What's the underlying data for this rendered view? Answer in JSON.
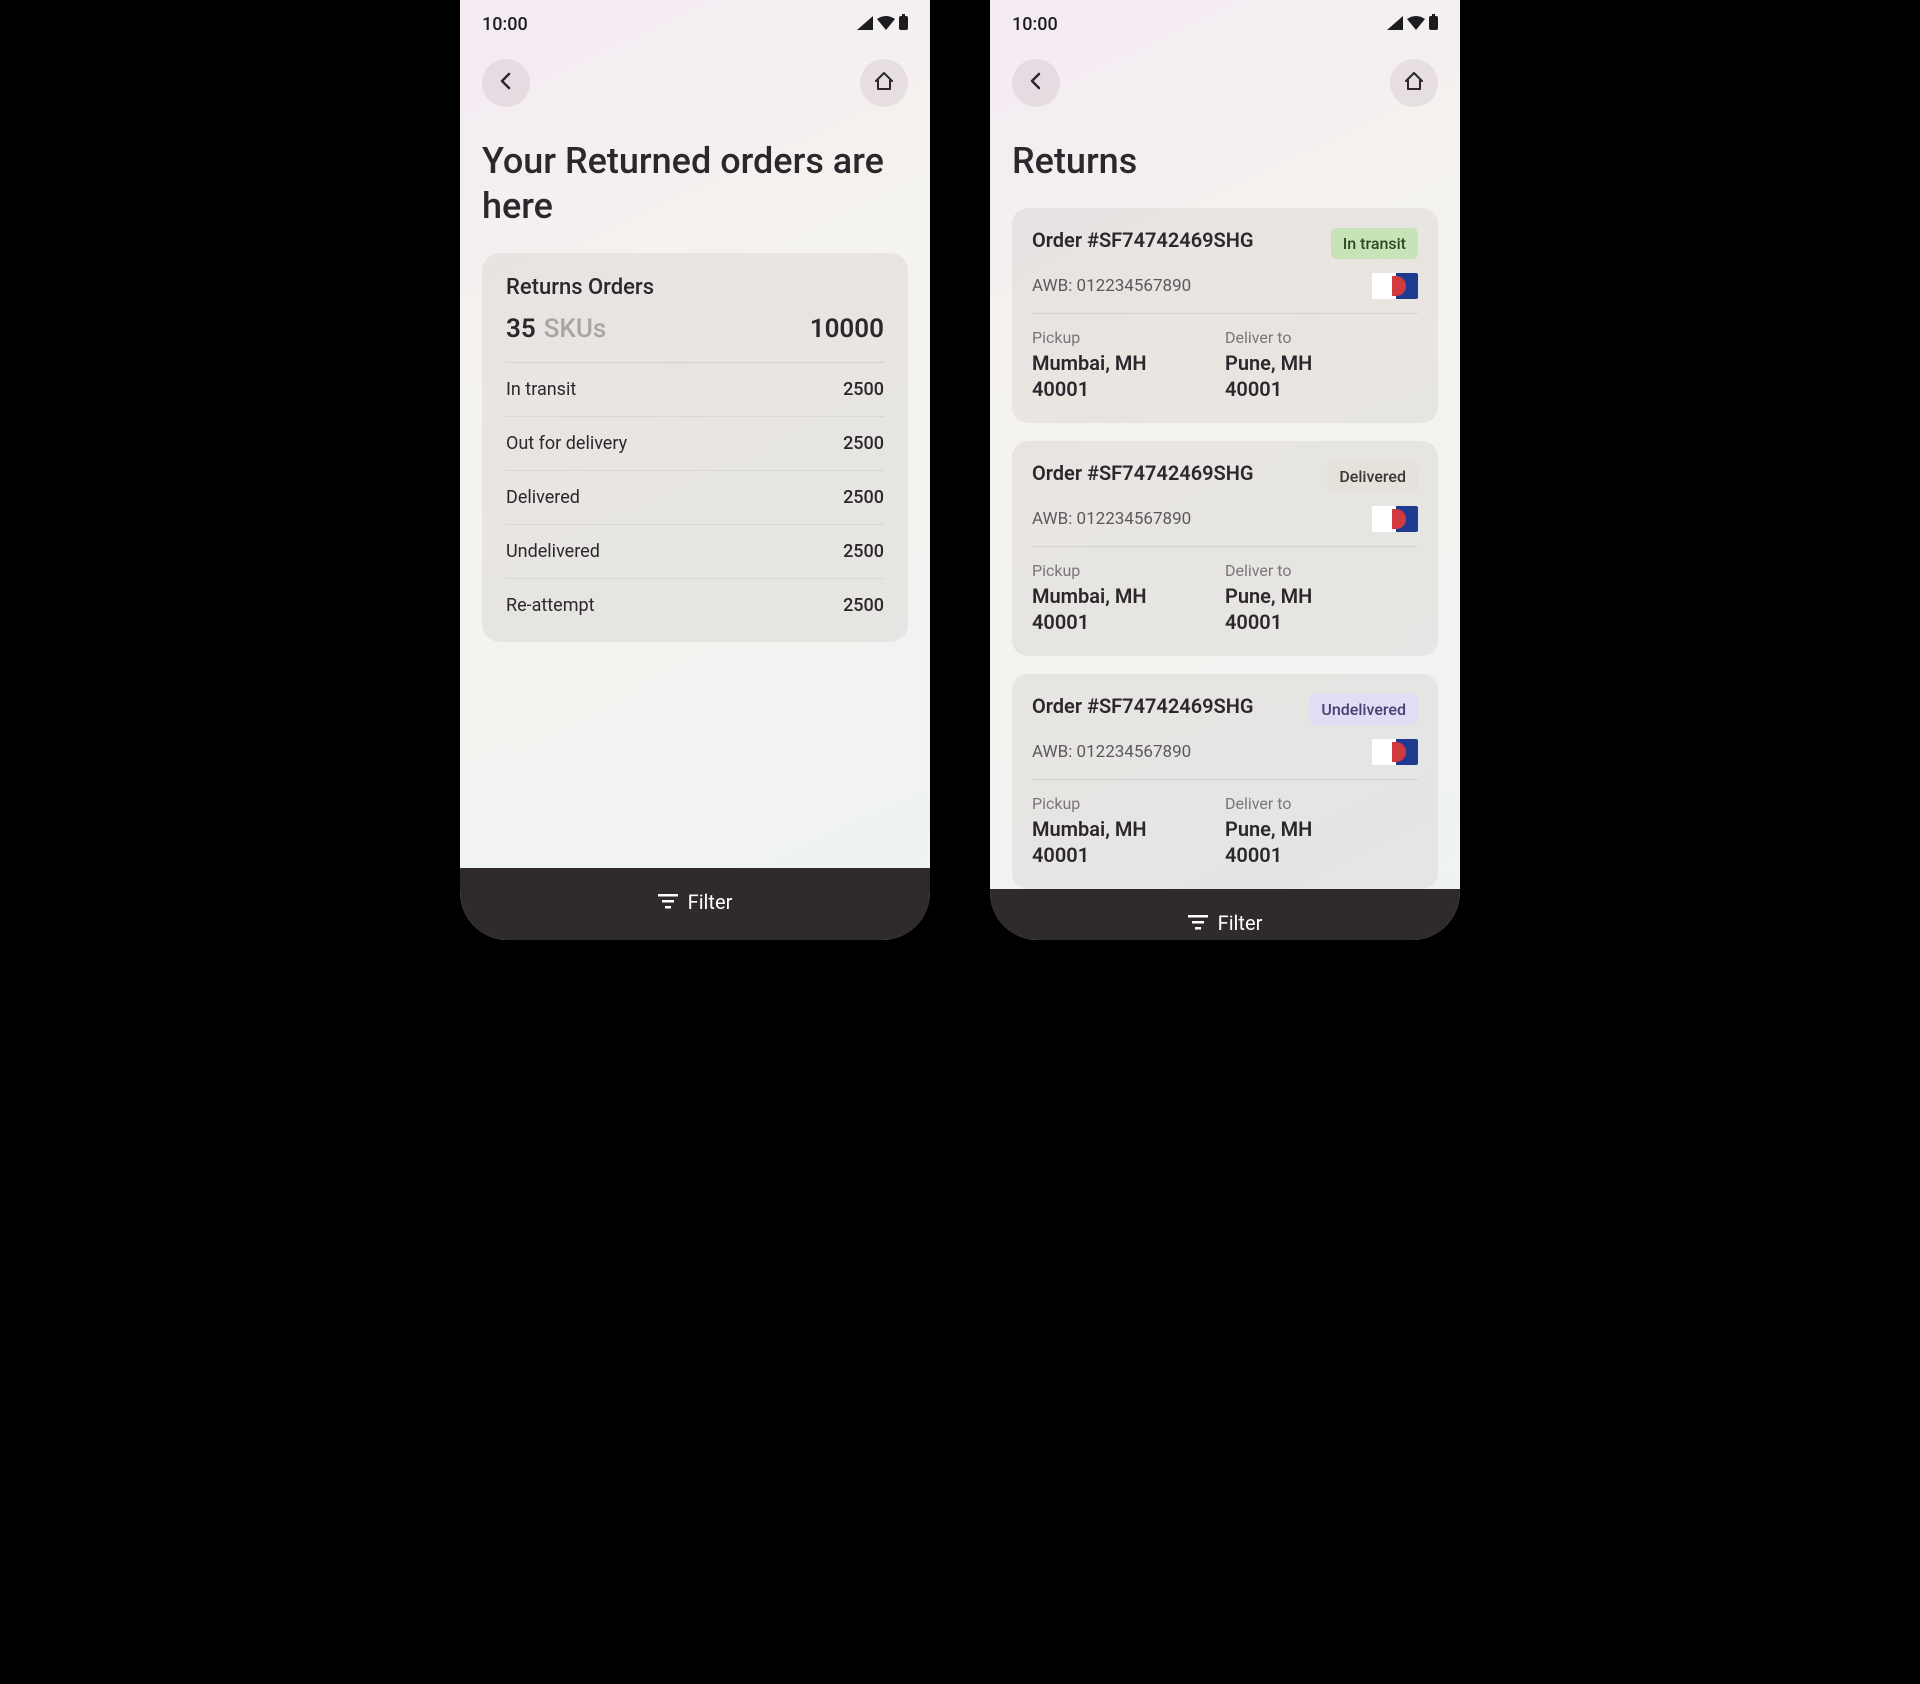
{
  "statusbar": {
    "time": "10:00"
  },
  "screen1": {
    "title": "Your Returned orders are here",
    "summary": {
      "title": "Returns Orders",
      "sku_count": "35",
      "sku_label": "SKUs",
      "total": "10000",
      "rows": [
        {
          "label": "In transit",
          "value": "2500"
        },
        {
          "label": "Out for delivery",
          "value": "2500"
        },
        {
          "label": "Delivered",
          "value": "2500"
        },
        {
          "label": "Undelivered",
          "value": "2500"
        },
        {
          "label": "Re-attempt",
          "value": "2500"
        }
      ]
    },
    "footer": {
      "filter": "Filter"
    }
  },
  "screen2": {
    "title": "Returns",
    "orders": [
      {
        "id": "Order #SF74742469SHG",
        "status": "In transit",
        "status_kind": "transit",
        "awb": "AWB: 012234567890",
        "pickup_label": "Pickup",
        "pickup_city": "Mumbai, MH",
        "pickup_pin": "40001",
        "deliver_label": "Deliver to",
        "deliver_city": "Pune, MH",
        "deliver_pin": "40001"
      },
      {
        "id": "Order #SF74742469SHG",
        "status": "Delivered",
        "status_kind": "delivered",
        "awb": "AWB: 012234567890",
        "pickup_label": "Pickup",
        "pickup_city": "Mumbai, MH",
        "pickup_pin": "40001",
        "deliver_label": "Deliver to",
        "deliver_city": "Pune, MH",
        "deliver_pin": "40001"
      },
      {
        "id": "Order #SF74742469SHG",
        "status": "Undelivered",
        "status_kind": "undelivered",
        "awb": "AWB: 012234567890",
        "pickup_label": "Pickup",
        "pickup_city": "Mumbai, MH",
        "pickup_pin": "40001",
        "deliver_label": "Deliver to",
        "deliver_city": "Pune, MH",
        "deliver_pin": "40001"
      }
    ],
    "footer": {
      "filter": "Filter"
    }
  }
}
